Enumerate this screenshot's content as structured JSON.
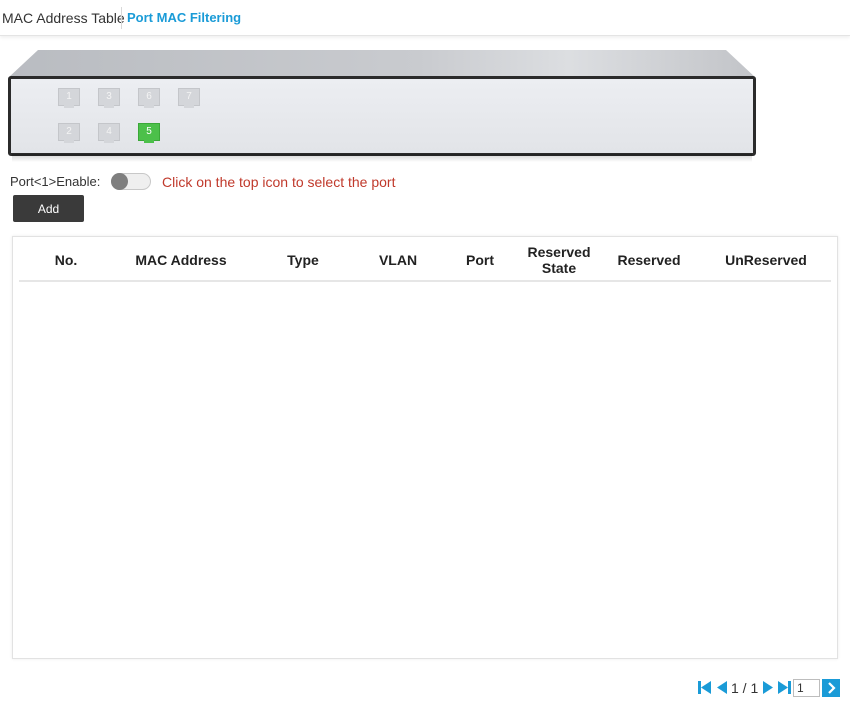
{
  "tabs": [
    {
      "label": "MAC Address Table"
    },
    {
      "label": "Port MAC Filtering"
    }
  ],
  "device": {
    "ports": [
      {
        "number": "1",
        "active": false
      },
      {
        "number": "3",
        "active": false
      },
      {
        "number": "6",
        "active": false
      },
      {
        "number": "7",
        "active": false
      },
      {
        "number": "2",
        "active": false
      },
      {
        "number": "4",
        "active": false
      },
      {
        "number": "5",
        "active": true
      }
    ],
    "active_color": "#4cc04a"
  },
  "enable": {
    "label": "Port<1>Enable:",
    "enabled": false,
    "hint": "Click on the top icon to select the port",
    "hint_color": "#c0392b"
  },
  "add_button": {
    "label": "Add"
  },
  "table": {
    "columns": [
      "No.",
      "MAC Address",
      "Type",
      "VLAN",
      "Port",
      "Reserved State",
      "Reserved",
      "UnReserved"
    ],
    "rows": []
  },
  "pagination": {
    "page_text": "1 / 1",
    "page_input": "1",
    "icons": [
      "first-page-icon",
      "prev-page-icon",
      "next-page-icon",
      "last-page-icon",
      "go-arrow-icon"
    ]
  },
  "accent_color": "#1a9bd7"
}
